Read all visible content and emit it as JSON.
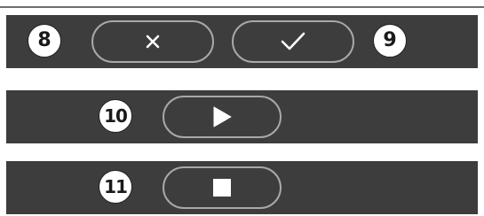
{
  "badges": {
    "cancel_step": "8",
    "confirm_step": "9",
    "play_step": "10",
    "stop_step": "11"
  },
  "buttons": {
    "cancel": {
      "icon": "close-icon"
    },
    "confirm": {
      "icon": "check-icon"
    },
    "play": {
      "icon": "play-icon"
    },
    "stop": {
      "icon": "stop-icon"
    }
  },
  "colors": {
    "bar_background": "#3d3d3d",
    "button_outline": "#a8a8a8",
    "icon": "#ffffff",
    "badge_background": "#ffffff",
    "badge_text": "#1a1a1a"
  }
}
